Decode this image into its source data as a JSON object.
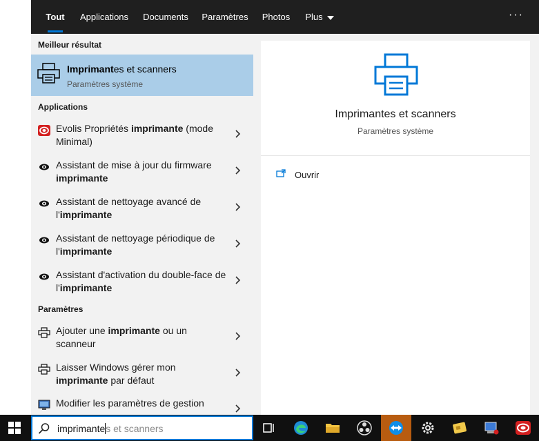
{
  "tabs": [
    {
      "label": "Tout"
    },
    {
      "label": "Applications"
    },
    {
      "label": "Documents"
    },
    {
      "label": "Paramètres"
    },
    {
      "label": "Photos"
    },
    {
      "label": "Plus"
    }
  ],
  "more_menu": "···",
  "sections": {
    "best": "Meilleur résultat",
    "apps": "Applications",
    "settings": "Paramètres"
  },
  "best_result": {
    "title_bold": "Imprimant",
    "title_rest": "es et scanners",
    "subtitle": "Paramètres système"
  },
  "apps": [
    {
      "pre": "Evolis Propriétés ",
      "bold": "imprimante",
      "post": " (mode Minimal)",
      "icon": "evolis-icon"
    },
    {
      "pre": "Assistant de mise à jour du firmware ",
      "bold": "imprimante",
      "post": "",
      "icon": "eye-icon"
    },
    {
      "pre": "Assistant de nettoyage avancé de l'",
      "bold": "imprimante",
      "post": "",
      "icon": "eye-icon"
    },
    {
      "pre": "Assistant de nettoyage périodique de l'",
      "bold": "imprimante",
      "post": "",
      "icon": "eye-icon"
    },
    {
      "pre": "Assistant d'activation du double-face de l'",
      "bold": "imprimante",
      "post": "",
      "icon": "eye-icon"
    }
  ],
  "settings": [
    {
      "pre": "Ajouter une ",
      "bold": "imprimante",
      "post": " ou un scanneur",
      "icon": "printer-icon"
    },
    {
      "pre": "Laisser Windows gérer mon ",
      "bold": "imprimante",
      "post": " par défaut",
      "icon": "printer-icon"
    },
    {
      "pre": "Modifier les paramètres de gestion",
      "bold": "",
      "post": "",
      "icon": "monitor-icon"
    }
  ],
  "preview": {
    "title": "Imprimantes et scanners",
    "subtitle": "Paramètres système",
    "open_label": "Ouvrir"
  },
  "search": {
    "typed": "imprimante",
    "hint": "s et scanners"
  },
  "colors": {
    "accent": "#0078d7",
    "selected": "#aacde8",
    "topbar": "#1f1f1f",
    "taskbar": "#101010"
  }
}
